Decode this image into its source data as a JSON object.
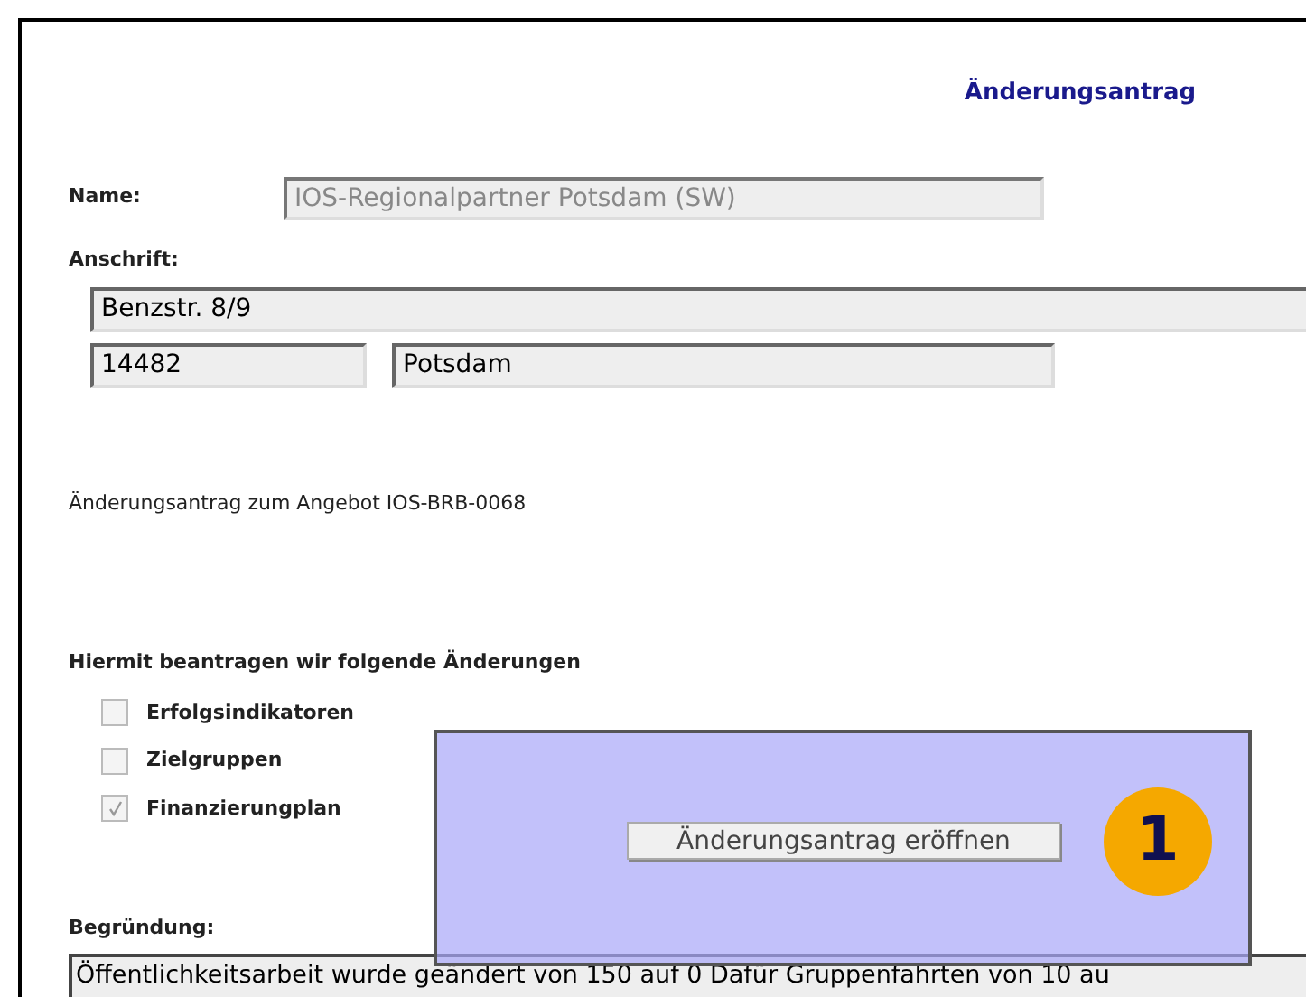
{
  "form_title": "Änderungsantrag",
  "name": {
    "label": "Name:",
    "value": "IOS-Regionalpartner Potsdam (SW)",
    "disabled": true
  },
  "address": {
    "label": "Anschrift:",
    "street": "Benzstr. 8/9",
    "zip": "14482",
    "city": "Potsdam"
  },
  "offer_text": "Änderungsantrag zum Angebot IOS-BRB-0068",
  "changes": {
    "heading": "Hiermit beantragen wir folgende Änderungen",
    "items": [
      {
        "label": "Erfolgsindikatoren",
        "checked": false
      },
      {
        "label": "Zielgruppen",
        "checked": false
      },
      {
        "label": "Finanzierungplan",
        "checked": true
      }
    ]
  },
  "reason": {
    "label": "Begründung:",
    "value": "Öffentlichkeitsarbeit wurde geändert von 150 auf 0 Dafür Gruppenfahrten von 10 au"
  },
  "callout": {
    "button": "Änderungsantrag eröffnen",
    "badge": "1"
  }
}
